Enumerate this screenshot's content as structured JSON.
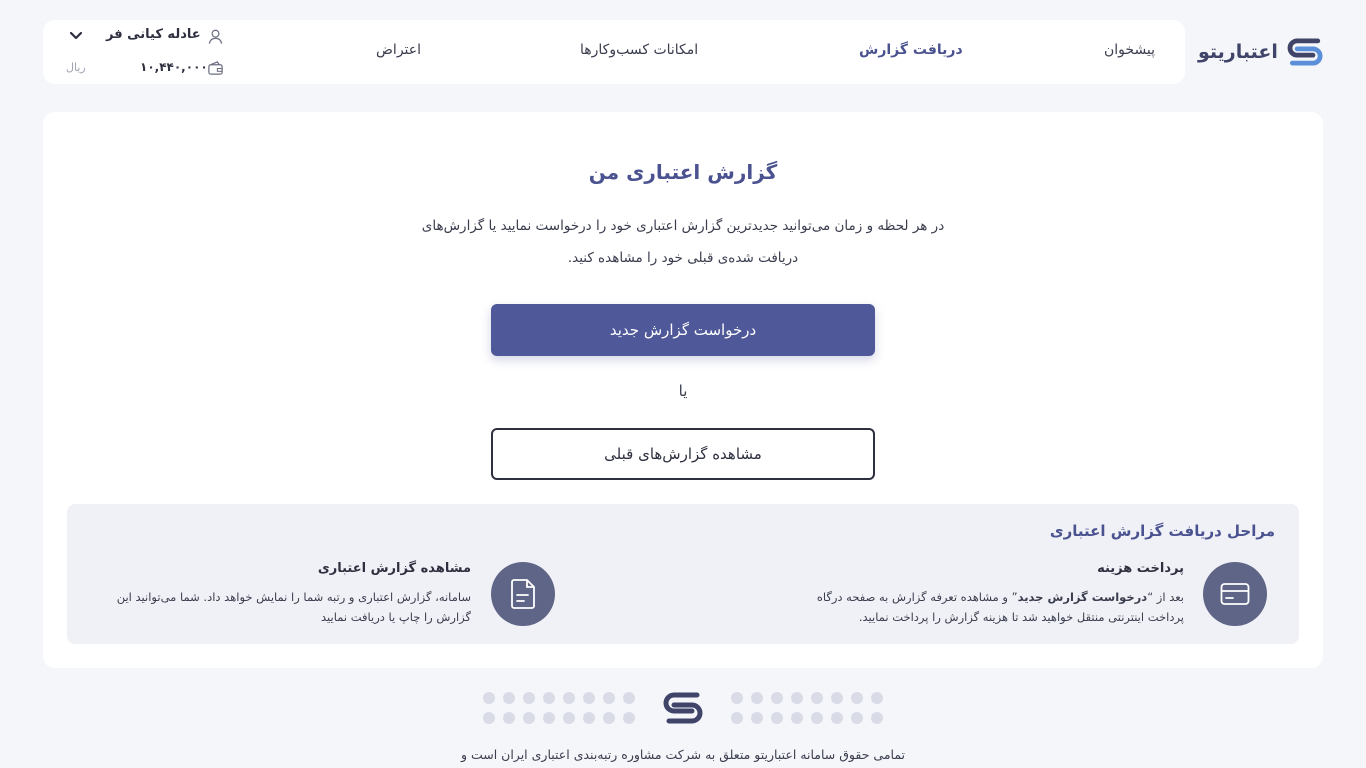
{
  "header": {
    "brand": "اعتباریتو",
    "nav": [
      {
        "label": "پیشخوان",
        "active": false
      },
      {
        "label": "دریافت گزارش",
        "active": true
      },
      {
        "label": "امکانات کسب‌وکارها",
        "active": false
      },
      {
        "label": "اعتراض",
        "active": false
      }
    ],
    "user_name": "عادله کیانی فر",
    "balance": "۱۰,۴۴۰,۰۰۰",
    "currency": "ریال"
  },
  "main": {
    "title": "گزارش اعتباری من",
    "description": "در هر لحظه و زمان می‌توانید جدیدترین گزارش اعتباری خود را درخواست نمایید یا گزارش‌های دریافت شده‌ی قبلی خود را مشاهده کنید.",
    "primary_button": "درخواست گزارش جدید",
    "or_text": "یا",
    "secondary_button": "مشاهده گزارش‌های قبلی"
  },
  "steps": {
    "title": "مراحل دریافت گزارش اعتباری",
    "items": [
      {
        "title": "پرداخت هزینه",
        "desc_prefix": "بعد از “",
        "desc_bold": "درخواست گزارش جدید",
        "desc_suffix": "” و مشاهده تعرفه گزارش به صفحه درگاه پرداخت اینترنتی منتقل خواهید شد تا هزینه گزارش را پرداخت نمایید.",
        "icon": "card-icon"
      },
      {
        "title": "مشاهده گزارش اعتباری",
        "desc": "سامانه، گزارش اعتباری و رتبه شما را نمایش خواهد داد. شما می‌توانید این گزارش را چاپ یا دریافت نمایید",
        "icon": "document-icon"
      }
    ]
  },
  "footer": {
    "copyright": "تمامی حقوق سامانه اعتباریتو متعلق به شرکت مشاوره رتبه‌بندی اعتباری ایران است و"
  },
  "colors": {
    "accent": "#4f5899",
    "title": "#4a5290",
    "icon_bg": "#5f6586",
    "page_bg": "#f5f6fa"
  }
}
